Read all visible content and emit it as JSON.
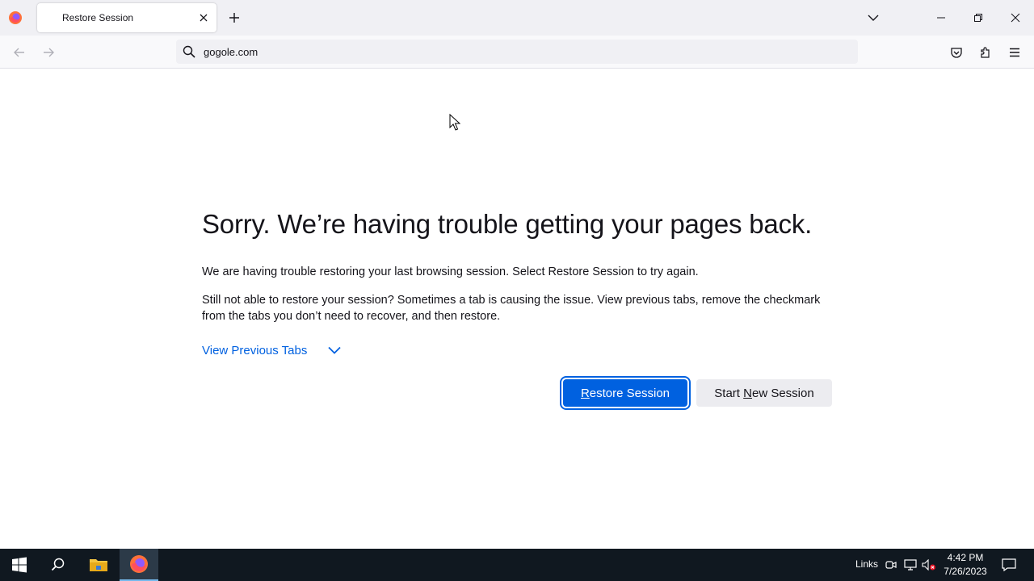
{
  "browser": {
    "tab": {
      "title": "Restore Session"
    },
    "urlbar": {
      "value": "gogole.com"
    }
  },
  "page": {
    "headline": "Sorry. We’re having trouble getting your pages back.",
    "paragraph1": "We are having trouble restoring your last browsing session. Select Restore Session to try again.",
    "paragraph2": "Still not able to restore your session? Sometimes a tab is causing the issue. View previous tabs, remove the checkmark from the tabs you don’t need to recover, and then restore.",
    "view_previous_tabs": "View Previous Tabs",
    "restore_button": {
      "access_key": "R",
      "rest": "estore Session"
    },
    "new_session_button": {
      "prefix": "Start ",
      "access_key": "N",
      "rest": "ew Session"
    }
  },
  "taskbar": {
    "links_label": "Links",
    "clock_time": "4:42 PM",
    "clock_date": "7/26/2023"
  },
  "colors": {
    "accent": "#0061e0",
    "taskbar_bg": "#101820"
  }
}
